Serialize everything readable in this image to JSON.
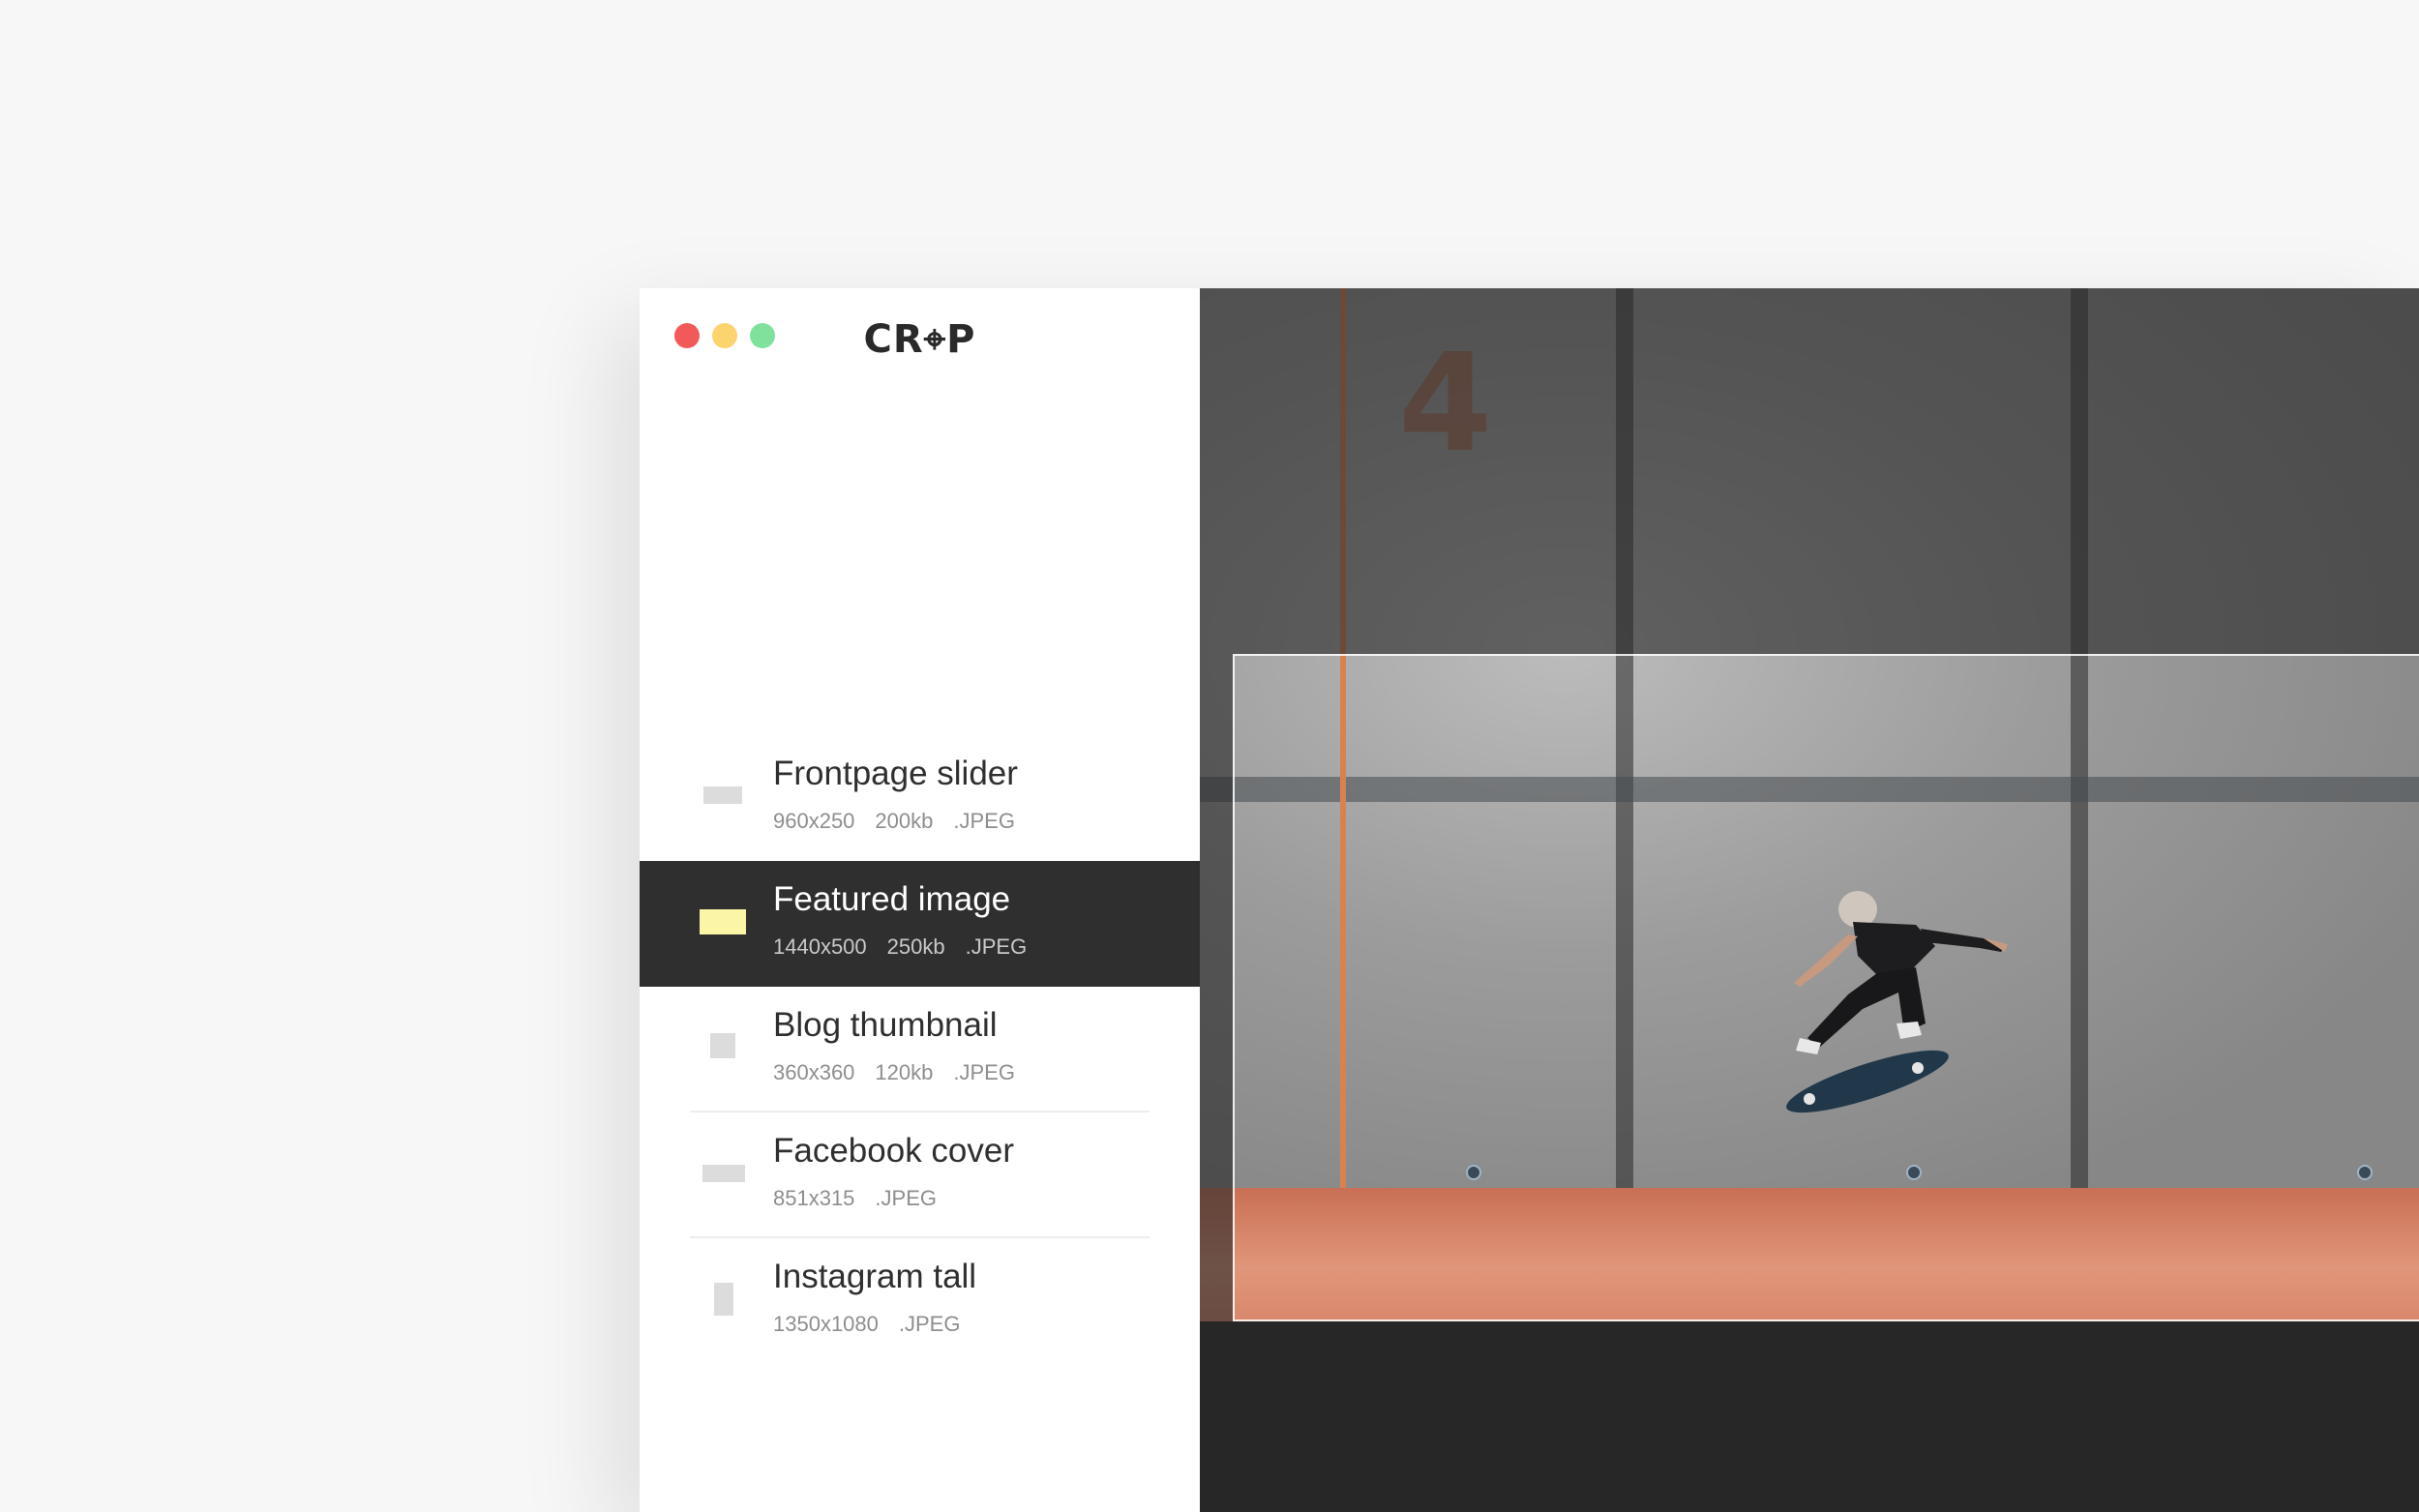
{
  "app": {
    "logo": "CR⌖P"
  },
  "window_controls": {
    "close_icon": "red-dot",
    "minimize_icon": "yellow-dot",
    "maximize_icon": "green-dot"
  },
  "sizes": [
    {
      "name": "Frontpage slider",
      "dimensions": "960x250",
      "filesize": "200kb",
      "format": ".JPEG",
      "active": false
    },
    {
      "name": "Featured image",
      "dimensions": "1440x500",
      "filesize": "250kb",
      "format": ".JPEG",
      "active": true
    },
    {
      "name": "Blog thumbnail",
      "dimensions": "360x360",
      "filesize": "120kb",
      "format": ".JPEG",
      "active": false
    },
    {
      "name": "Facebook cover",
      "dimensions": "851x315",
      "filesize": "",
      "format": ".JPEG",
      "active": false
    },
    {
      "name": "Instagram tall",
      "dimensions": "1350x1080",
      "filesize": "",
      "format": ".JPEG",
      "active": false
    }
  ],
  "canvas": {
    "wall_number": "4"
  },
  "colors": {
    "active_row": "#2f2f2f",
    "active_thumb": "#fbf5a6",
    "thumb": "#dcdcdc",
    "canvas_bg": "#272727"
  }
}
